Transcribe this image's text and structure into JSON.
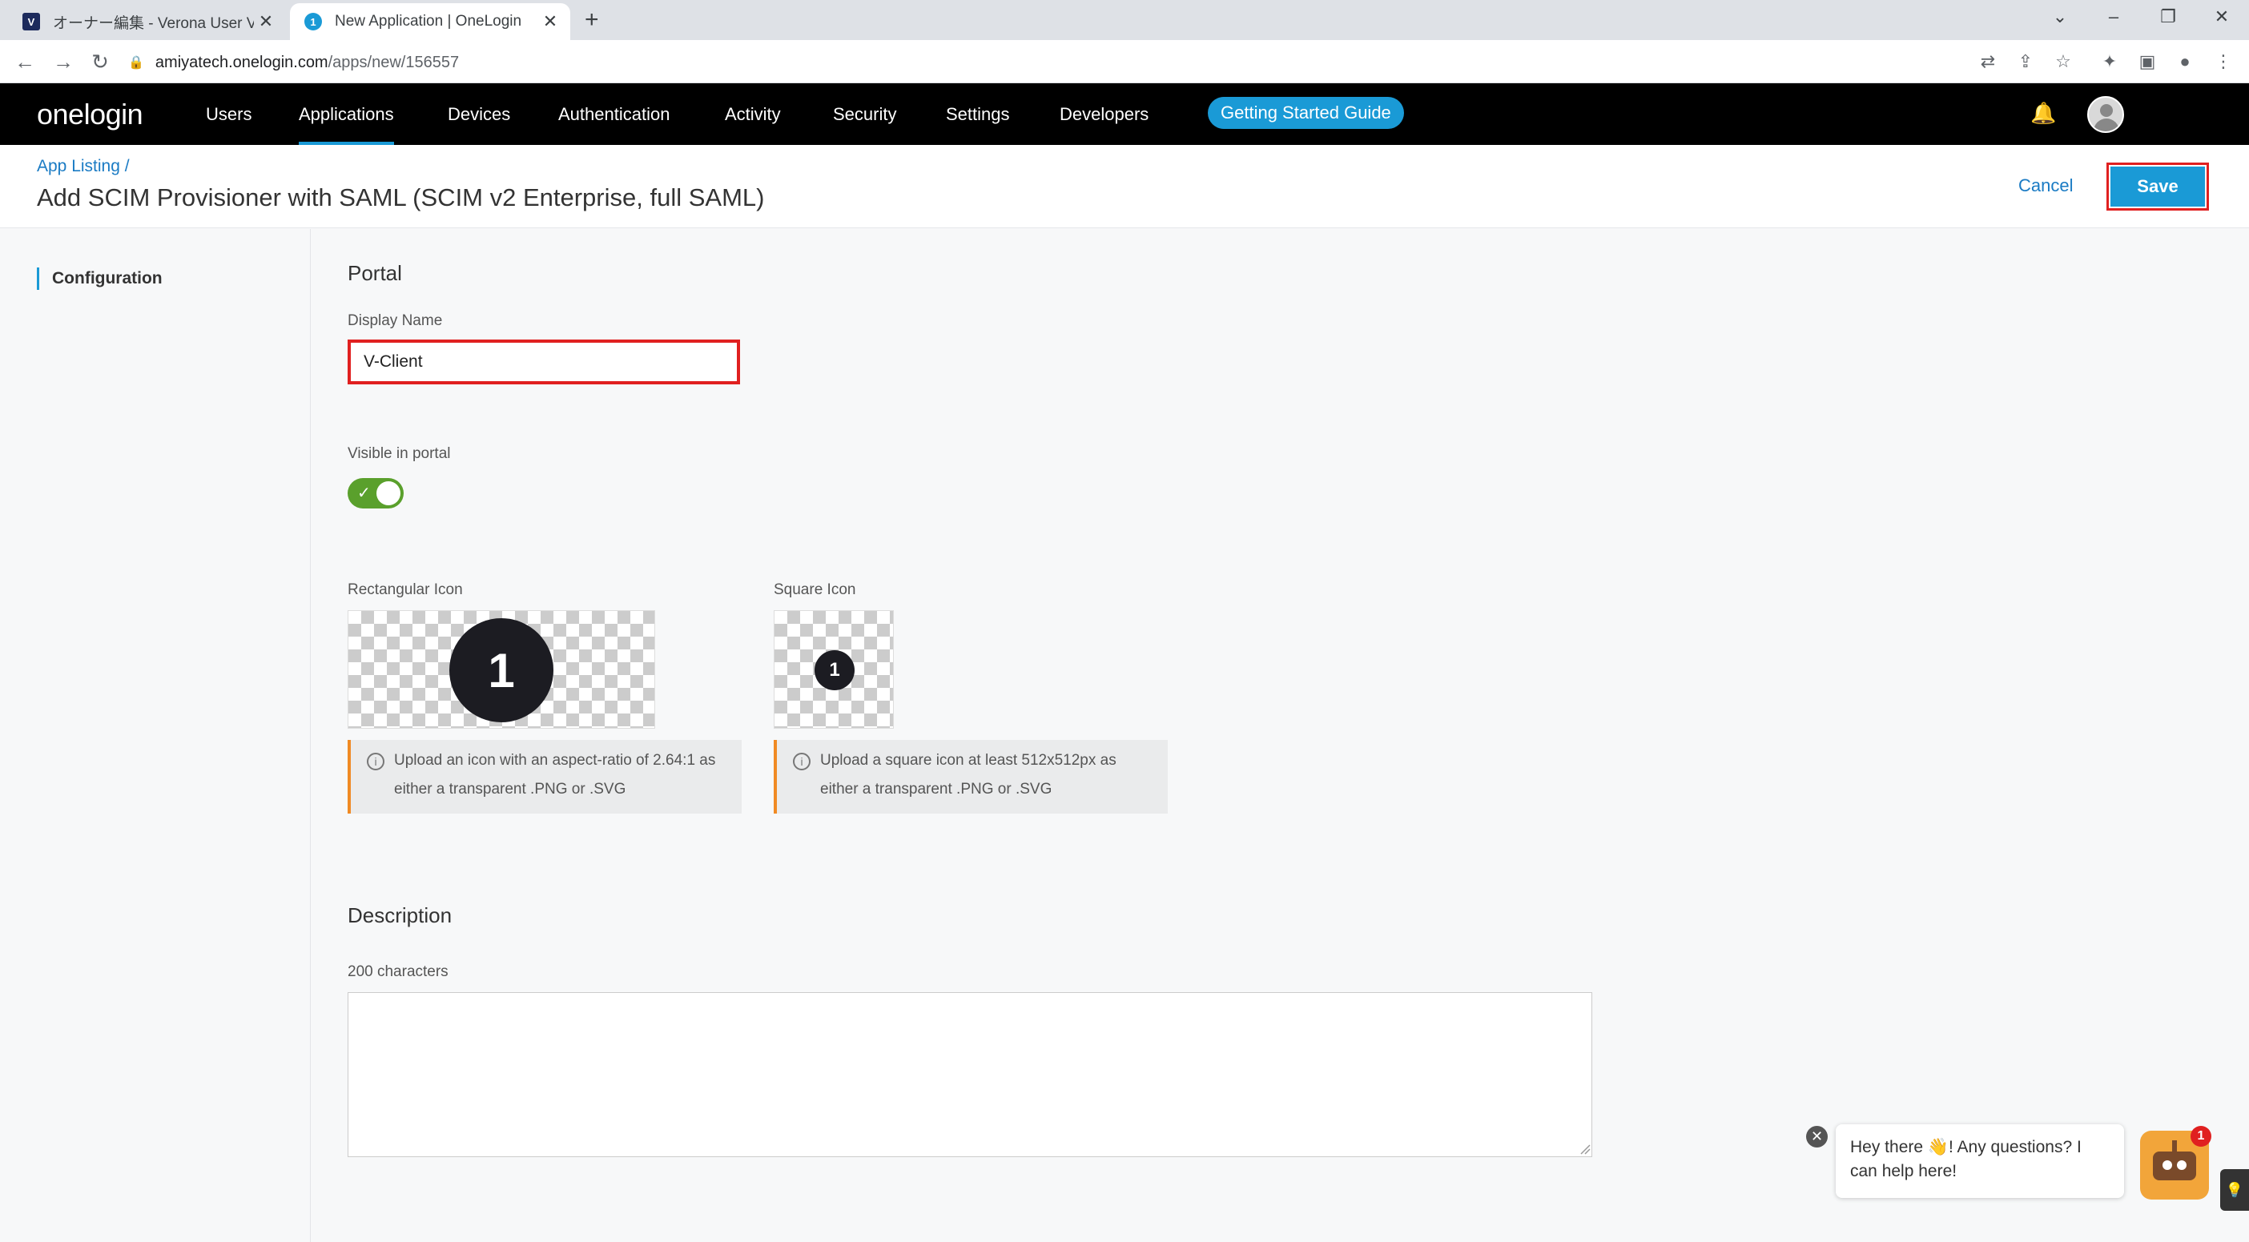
{
  "browser": {
    "tabs": [
      {
        "favicon": "V",
        "title": "オーナー編集 - Verona User View",
        "close": "✕"
      },
      {
        "favicon": "1",
        "title": "New Application | OneLogin",
        "close": "✕"
      }
    ],
    "new_tab": "+",
    "url_host": "amiyatech.onelogin.com",
    "url_path": "/apps/new/156557"
  },
  "app": {
    "logo": "onelogin",
    "nav": [
      "Users",
      "Applications",
      "Devices",
      "Authentication",
      "Activity",
      "Security",
      "Settings",
      "Developers"
    ],
    "active_nav": "Applications",
    "guide_button": "Getting Started Guide"
  },
  "header": {
    "breadcrumb": "App Listing /",
    "title": "Add SCIM Provisioner with SAML (SCIM v2 Enterprise, full SAML)",
    "cancel": "Cancel",
    "save": "Save"
  },
  "sidebar": {
    "items": [
      {
        "label": "Configuration",
        "active": true
      }
    ]
  },
  "portal": {
    "title": "Portal",
    "display_name_label": "Display Name",
    "display_name_value": "V-Client",
    "visible_label": "Visible in portal",
    "visible": true,
    "rect_icon_label": "Rectangular Icon",
    "square_icon_label": "Square Icon",
    "icon_glyph": "1",
    "rect_info": "Upload an icon with an aspect-ratio of 2.64:1 as either a transparent .PNG or .SVG",
    "square_info": "Upload a square icon at least 512x512px as either a transparent .PNG or .SVG"
  },
  "description": {
    "title": "Description",
    "counter": "200 characters",
    "value": ""
  },
  "chat": {
    "message": "Hey there 👋! Any questions? I can help here!",
    "badge": "1"
  },
  "colors": {
    "accent": "#1a9ad6",
    "highlight": "#e02020",
    "toggle_on": "#5aa02c",
    "info_border": "#f08a24"
  }
}
